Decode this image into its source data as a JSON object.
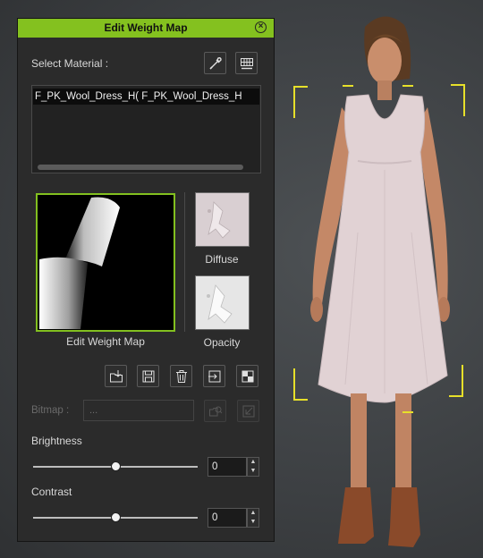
{
  "panel": {
    "title": "Edit Weight Map",
    "select_material_label": "Select Material :",
    "material_items": [
      "F_PK_Wool_Dress_H( F_PK_Wool_Dress_H"
    ],
    "captions": {
      "weight_map": "Edit Weight Map",
      "diffuse": "Diffuse",
      "opacity": "Opacity"
    },
    "bitmap_label": "Bitmap :",
    "bitmap_value": "...",
    "brightness": {
      "label": "Brightness",
      "value": "0",
      "level": 0.5
    },
    "contrast": {
      "label": "Contrast",
      "value": "0",
      "level": 0.5
    }
  },
  "icons": {
    "close": "close-icon",
    "picker": "eyedropper-icon",
    "grid": "grid-icon",
    "load": "load-icon",
    "save": "save-icon",
    "delete": "trash-icon",
    "export": "export-icon",
    "invert": "invert-icon"
  },
  "colors": {
    "accent": "#84c11f",
    "bracket": "#e7e02a",
    "panel_bg": "#2b2b2b"
  }
}
